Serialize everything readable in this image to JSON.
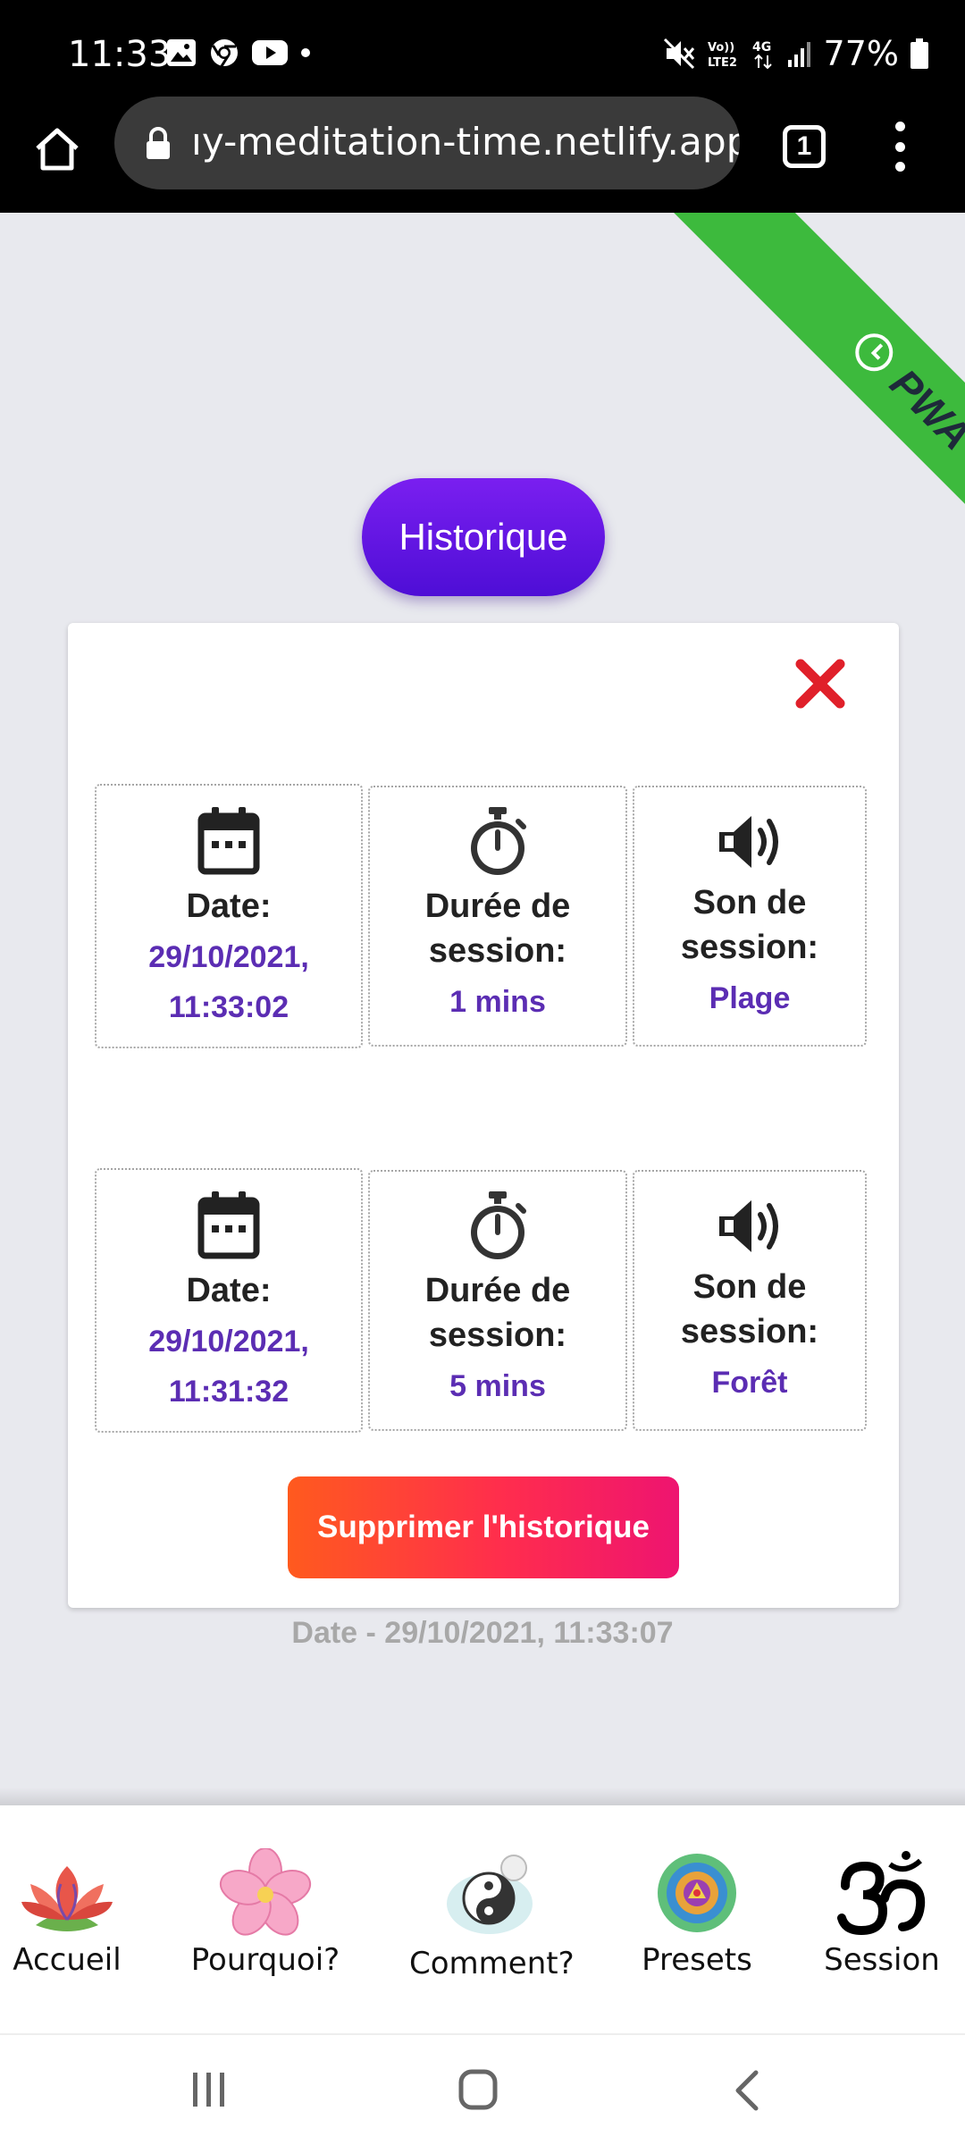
{
  "status_bar": {
    "time": "11:33",
    "battery": "77%"
  },
  "browser": {
    "url": "ıy-meditation-time.netlify.app",
    "tab_count": "1"
  },
  "ribbon": {
    "label": "PWA",
    "color": "#3dba3d"
  },
  "page": {
    "title_button": "Historique",
    "delete_button": "Supprimer l'historique",
    "footer_date": "Date - 29/10/2021, 11:33:07"
  },
  "history": {
    "entries": [
      {
        "date_label": "Date:",
        "date_value_line1": "29/10/2021,",
        "date_value_line2": "11:33:02",
        "duration_label_line1": "Durée de",
        "duration_label_line2": "session:",
        "duration_value": "1 mins",
        "sound_label_line1": "Son de",
        "sound_label_line2": "session:",
        "sound_value": "Plage"
      },
      {
        "date_label": "Date:",
        "date_value_line1": "29/10/2021,",
        "date_value_line2": "11:31:32",
        "duration_label_line1": "Durée de",
        "duration_label_line2": "session:",
        "duration_value": "5 mins",
        "sound_label_line1": "Son de",
        "sound_label_line2": "session:",
        "sound_value": "Forêt"
      }
    ]
  },
  "nav": {
    "items": [
      {
        "label": "Accueil",
        "icon": "lotus-icon"
      },
      {
        "label": "Pourquoi?",
        "icon": "flower-icon"
      },
      {
        "label": "Comment?",
        "icon": "yin-yang-icon"
      },
      {
        "label": "Presets",
        "icon": "mandala-icon"
      },
      {
        "label": "Session",
        "icon": "om-icon"
      }
    ]
  },
  "colors": {
    "accent_purple": "#5b2db3",
    "button_purple": "#6a17e8",
    "delete_gradient_start": "#ff5a1e",
    "delete_gradient_end": "#ee1470",
    "close_red": "#e0202a"
  }
}
